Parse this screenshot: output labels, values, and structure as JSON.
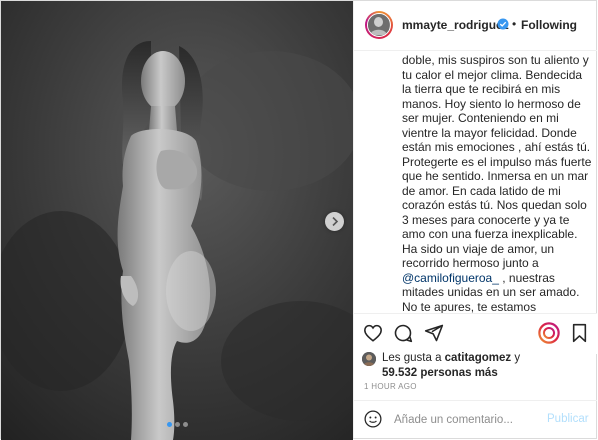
{
  "header": {
    "username": "mmayte_rodriguez",
    "separator": "•",
    "follow_label": "Following"
  },
  "caption": {
    "lines_1": "doble, mis suspiros son tu aliento y tu calor el mejor clima. Bendecida la tierra que te recibirá en mis manos. Hoy siento lo hermoso de ser mujer. Conteniendo en mi vientre la mayor felicidad. Donde están mis emociones , ahí estás tú.",
    "lines_2": "Protegerte es el impulso más fuerte que he sentido. Inmersa en un mar de amor. En cada latido de mi corazón estás tú. Nos quedan solo 3 meses para conocerte y ya te amo con una fuerza inexplicable.",
    "lines_3_before": "Ha sido un viaje de amor, un recorrido hermoso junto a",
    "mention": "@camilofigueroa_",
    "lines_3_after": " , nuestras mitades unidas en un ser amado. No te apures, te estamos esperando para mostrarte la vida desde nuestros ojos. Mágica y hermosa, y más ahora"
  },
  "likes": {
    "prefix": "Les gusta a ",
    "user": "catitagomez",
    "middle": " y",
    "count": "59.532 personas más"
  },
  "timestamp": "1 HOUR AGO",
  "comment": {
    "placeholder": "Añade un comentario...",
    "publish_label": "Publicar"
  },
  "carousel": {
    "slide_count": 3,
    "active_slide": 1
  },
  "colors": {
    "verified": "#3897f0",
    "active_dot": "#3897f0",
    "publish": "#b2dffc",
    "mention": "#003569"
  },
  "icons": [
    "verified-badge-icon",
    "chevron-right-icon",
    "heart-icon",
    "comment-icon",
    "share-icon",
    "story-circle-icon",
    "save-icon",
    "emoji-icon"
  ]
}
